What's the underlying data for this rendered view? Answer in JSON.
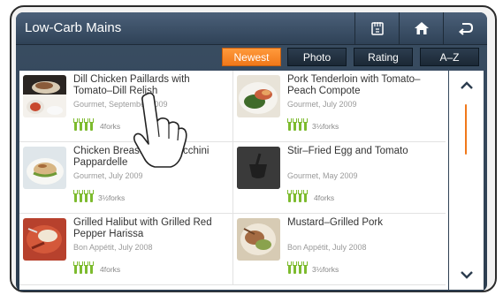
{
  "app": {
    "title": "Low-Carb Mains"
  },
  "toolbar": {
    "buttons": [
      {
        "name": "recipe-box-icon"
      },
      {
        "name": "home-icon"
      },
      {
        "name": "back-icon"
      }
    ]
  },
  "sort_tabs": [
    {
      "label": "Newest",
      "active": true
    },
    {
      "label": "Photo",
      "active": false
    },
    {
      "label": "Rating",
      "active": false
    },
    {
      "label": "A–Z",
      "active": false
    }
  ],
  "colors": {
    "accent": "#f0781a",
    "fork_green": "#7dbb2e",
    "titlebar": "#3a4e63"
  },
  "recipes": [
    {
      "name": "Dill Chicken Paillards with Tomato–Dill Relish",
      "source": "Gourmet, September 2009",
      "forks": 4,
      "forks_label": "4forks"
    },
    {
      "name": "Pork Tenderloin with Tomato–Peach Compote",
      "source": "Gourmet, July 2009",
      "forks": 3.5,
      "forks_label": "3½forks"
    },
    {
      "name": "Chicken Breasts with Zucchini Pappardelle",
      "source": "Gourmet, July 2009",
      "forks": 3.5,
      "forks_label": "3½forks"
    },
    {
      "name": "Stir–Fried Egg and Tomato",
      "source": "Gourmet, May 2009",
      "forks": 4,
      "forks_label": "4forks"
    },
    {
      "name": "Grilled Halibut with Grilled Red Pepper Harissa",
      "source": "Bon Appétit, July 2008",
      "forks": 4,
      "forks_label": "4forks"
    },
    {
      "name": "Mustard–Grilled Pork",
      "source": "Bon Appétit, July 2008",
      "forks": 3.5,
      "forks_label": "3½forks"
    }
  ],
  "scroll": {
    "up_icon": "chevron-up-icon",
    "down_icon": "chevron-down-icon"
  }
}
